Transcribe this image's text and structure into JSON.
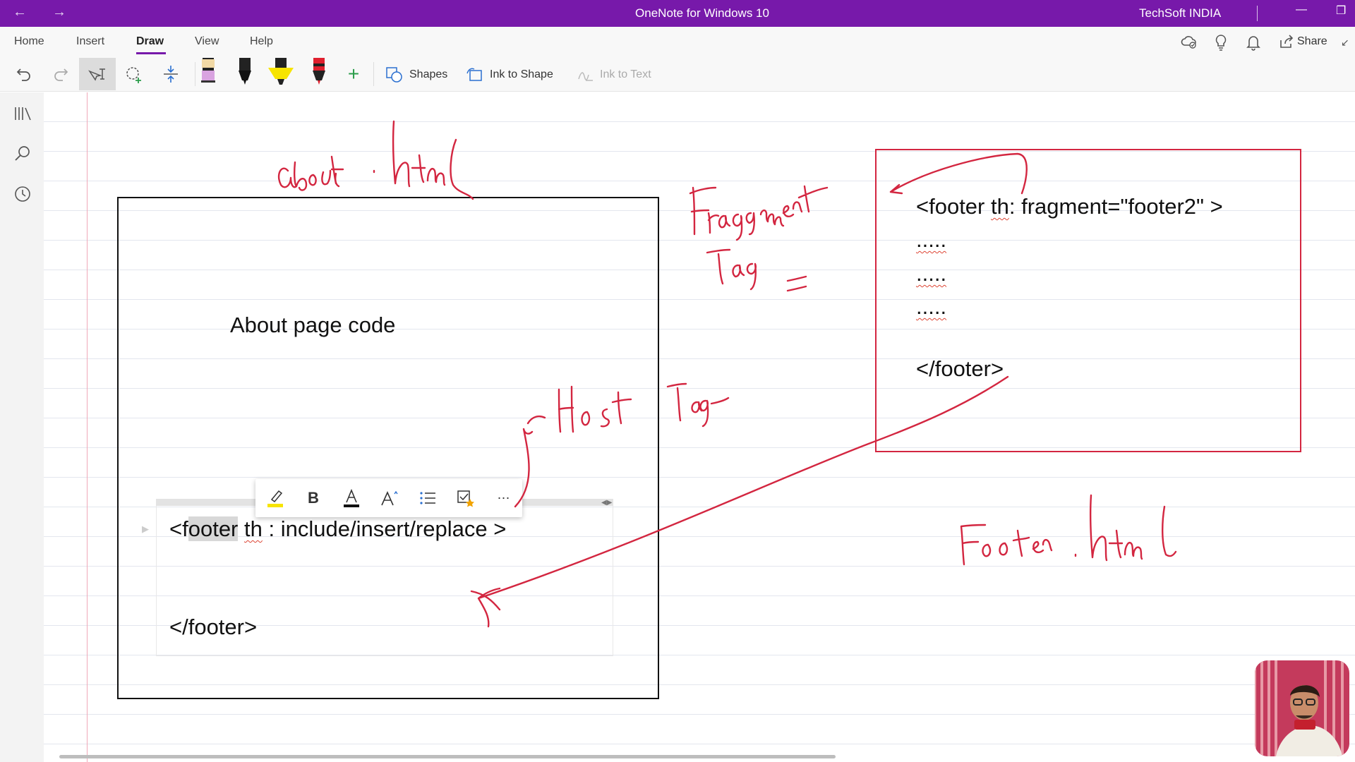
{
  "titlebar": {
    "title": "OneNote for Windows 10",
    "user": "TechSoft INDIA"
  },
  "menu": {
    "tabs": [
      "Home",
      "Insert",
      "Draw",
      "View",
      "Help"
    ],
    "active_tab": "Draw",
    "share_label": "Share"
  },
  "toolbar": {
    "shapes_label": "Shapes",
    "ink_to_shape_label": "Ink to Shape",
    "ink_to_text_label": "Ink to Text"
  },
  "pens": [
    {
      "name": "pink-highlighter",
      "color": "#d9a3e0"
    },
    {
      "name": "black-pen",
      "color": "#111111"
    },
    {
      "name": "yellow-highlighter",
      "color": "#f7e400"
    },
    {
      "name": "red-pen",
      "color": "#e0202e"
    }
  ],
  "page": {
    "about_box_text": "About page code",
    "host_open_tag_parts": [
      "<f",
      "oo",
      "ter",
      " ",
      "th",
      " : include/insert/replace >"
    ],
    "host_close_tag": "</footer>",
    "fragment_open_tag_parts": [
      "<footer ",
      "th",
      ": fragment=\"footer2\" >"
    ],
    "fragment_dots": [
      ".....",
      ".....",
      "....."
    ],
    "fragment_close_tag": "</footer>"
  },
  "ink_notes": [
    "about.html",
    "Fragment",
    "Tag =",
    "Host",
    "Tag",
    "Footer.html"
  ],
  "colors": {
    "accent": "#7719aa",
    "ink_red": "#d32640",
    "highlight": "#f7e400"
  }
}
